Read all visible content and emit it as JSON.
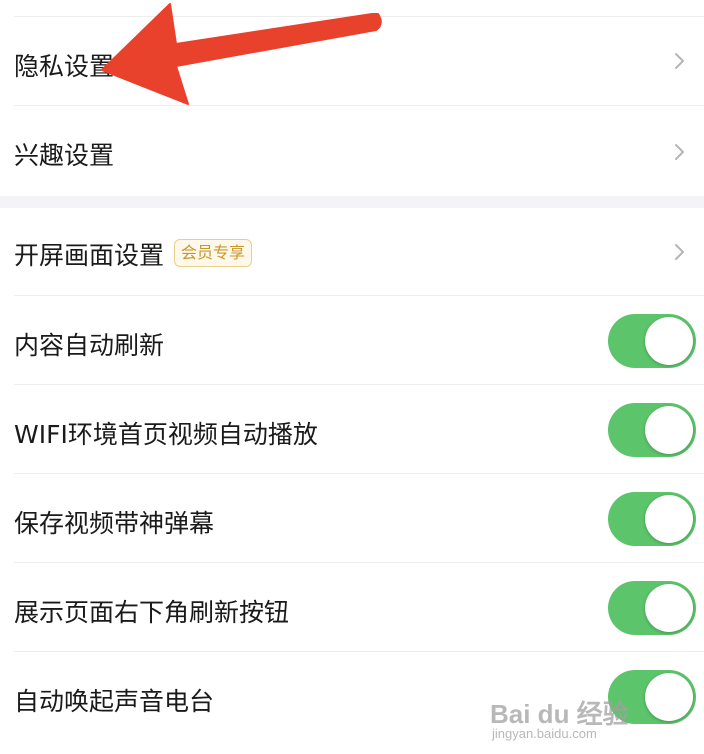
{
  "settings": {
    "group1": [
      {
        "label": "隐私设置",
        "type": "chevron"
      },
      {
        "label": "兴趣设置",
        "type": "chevron"
      }
    ],
    "group2": [
      {
        "label": "开屏画面设置",
        "badge": "会员专享",
        "type": "chevron"
      },
      {
        "label": "内容自动刷新",
        "type": "toggle",
        "on": true
      },
      {
        "label": "WIFI环境首页视频自动播放",
        "type": "toggle",
        "on": true
      },
      {
        "label": "保存视频带神弹幕",
        "type": "toggle",
        "on": true
      },
      {
        "label": "展示页面右下角刷新按钮",
        "type": "toggle",
        "on": true
      },
      {
        "label": "自动唤起声音电台",
        "type": "toggle",
        "on": true
      }
    ]
  },
  "colors": {
    "toggle_on": "#5cc46a",
    "badge_text": "#c9962c",
    "annotation_arrow": "#e8412c",
    "group_gap": "#f3f3f8"
  },
  "icons": {
    "chevron": "chevron-right-icon",
    "annotation": "red-arrow-annotation"
  },
  "watermark": {
    "main": "Bai du 经验",
    "sub": "jingyan.baidu.com"
  }
}
